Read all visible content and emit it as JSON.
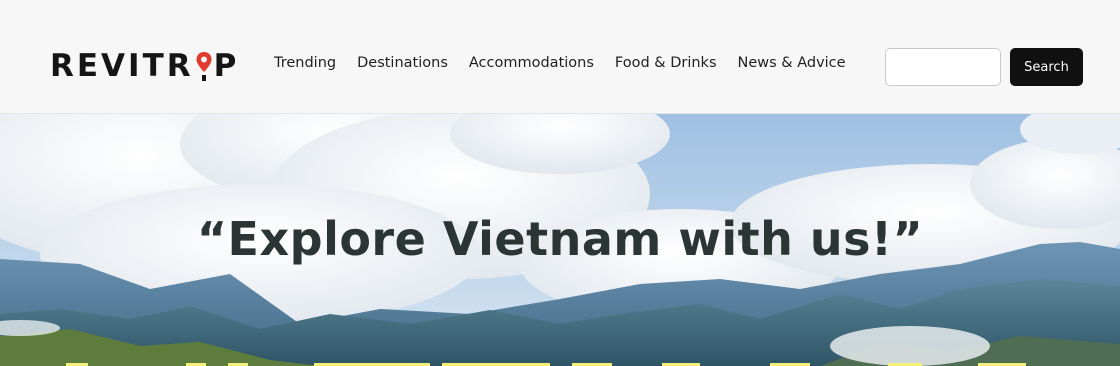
{
  "header": {
    "logo": {
      "left": "REVITR",
      "right": "P",
      "pin_color": "#e23a2e"
    },
    "nav": [
      "Trending",
      "Destinations",
      "Accommodations",
      "Food & Drinks",
      "News & Advice"
    ],
    "search": {
      "value": "",
      "button_label": "Search"
    }
  },
  "hero": {
    "title": "“Explore Vietnam with us!”",
    "background": "mountain-landscape-with-clouds"
  }
}
